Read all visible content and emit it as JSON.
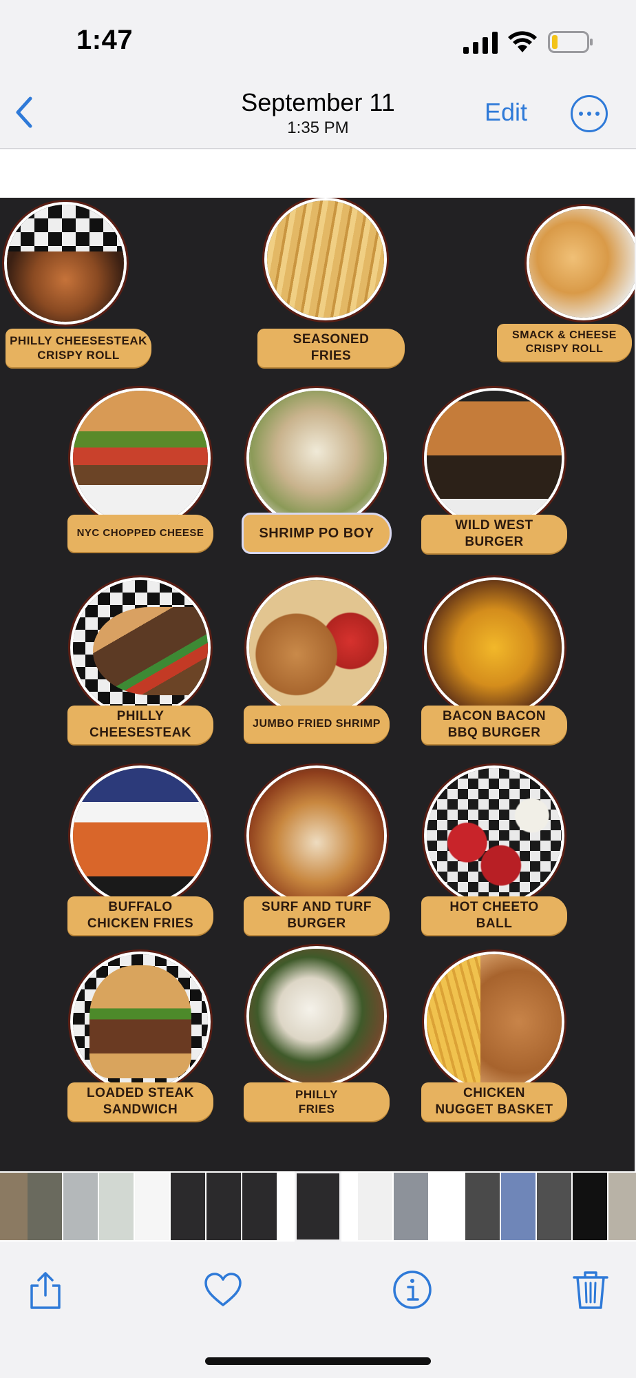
{
  "status_bar": {
    "time": "1:47",
    "icons": [
      "cellular-signal-icon",
      "wifi-icon",
      "battery-low-icon"
    ]
  },
  "nav": {
    "title": "September 11",
    "subtitle": "1:35 PM",
    "edit_label": "Edit",
    "back_icon": "chevron-left-icon",
    "more_icon": "ellipsis-circle-icon"
  },
  "menu": {
    "items": [
      {
        "label_line1": "PHILLY CHEESESTEAK",
        "label_line2": "CRISPY ROLL"
      },
      {
        "label_line1": "SEASONED",
        "label_line2": "FRIES"
      },
      {
        "label_line1": "SMACK & CHEESE",
        "label_line2": "CRISPY ROLL"
      },
      {
        "label_line1": "NYC CHOPPED  CHEESE",
        "label_line2": ""
      },
      {
        "label_line1": "SHRIMP PO BOY",
        "label_line2": ""
      },
      {
        "label_line1": "WILD WEST",
        "label_line2": "BURGER"
      },
      {
        "label_line1": "PHILLY",
        "label_line2": "CHEESESTEAK"
      },
      {
        "label_line1": "JUMBO FRIED SHRIMP",
        "label_line2": ""
      },
      {
        "label_line1": "BACON BACON",
        "label_line2": "BBQ BURGER"
      },
      {
        "label_line1": "BUFFALO",
        "label_line2": "CHICKEN FRIES"
      },
      {
        "label_line1": "SURF AND TURF",
        "label_line2": "BURGER"
      },
      {
        "label_line1": "HOT CHEETO",
        "label_line2": "BALL"
      },
      {
        "label_line1": "LOADED STEAK",
        "label_line2": "SANDWICH"
      },
      {
        "label_line1": "PHILLY",
        "label_line2": "FRIES"
      },
      {
        "label_line1": "CHICKEN",
        "label_line2": "NUGGET BASKET"
      }
    ]
  },
  "toolbar": {
    "icons": [
      "share-icon",
      "heart-icon",
      "info-icon",
      "trash-icon"
    ]
  },
  "colors": {
    "accent": "#2f7ad8",
    "flyer_background": "#222123",
    "label_pill": "#e7b25f",
    "label_text": "#2c1a0e"
  }
}
